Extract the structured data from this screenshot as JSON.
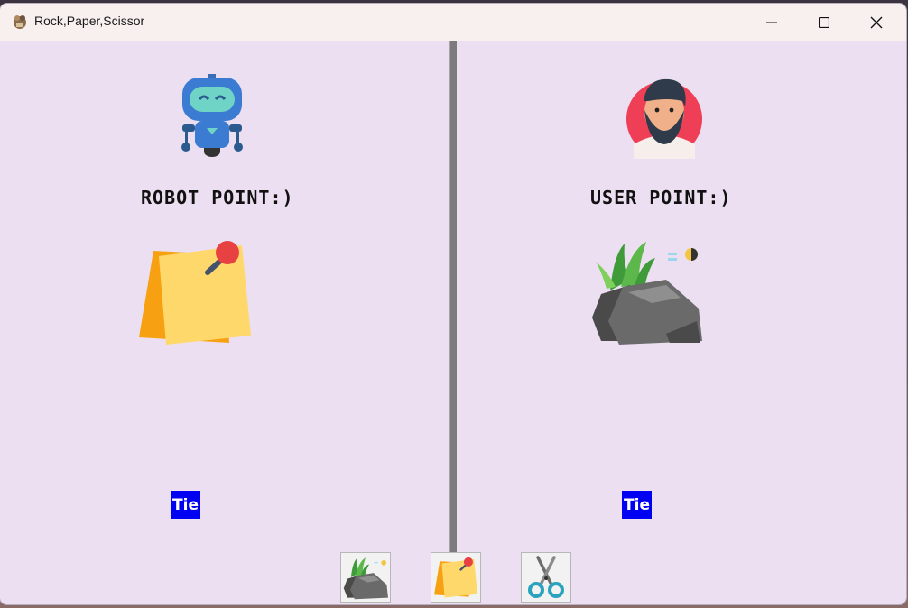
{
  "window": {
    "title": "Rock,Paper,Scissor",
    "controls": {
      "minimize": "minimize-icon",
      "maximize": "maximize-icon",
      "close": "close-icon"
    }
  },
  "robot": {
    "avatar_icon": "robot-icon",
    "score_label": "ROBOT POINT:)",
    "choice_icon": "paper-icon",
    "result": "Tie"
  },
  "user": {
    "avatar_icon": "user-avatar-icon",
    "score_label": "USER POINT:)",
    "choice_icon": "rock-icon",
    "result": "Tie"
  },
  "choices": [
    {
      "name": "rock",
      "icon": "rock-icon"
    },
    {
      "name": "paper",
      "icon": "paper-icon"
    },
    {
      "name": "scissor",
      "icon": "scissors-icon"
    }
  ],
  "colors": {
    "background": "#ecdff1",
    "titlebar": "#f8efef",
    "result_badge": "#0000f2",
    "divider": "#7d7a7d"
  }
}
